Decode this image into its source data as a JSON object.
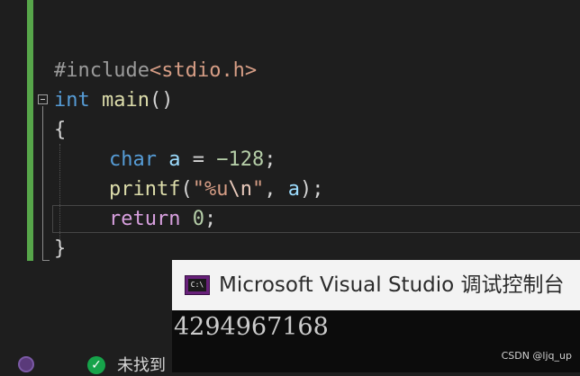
{
  "editor": {
    "lines": [
      {
        "tokens": [
          "#include",
          "<stdio.h>"
        ]
      },
      {
        "tokens": [
          "int",
          " ",
          "main",
          "()"
        ]
      },
      {
        "tokens": [
          "{"
        ]
      },
      {
        "tokens": [
          "char",
          " ",
          "a",
          " = ",
          "−128",
          ";"
        ]
      },
      {
        "tokens": [
          "printf",
          "(",
          "\"%u",
          "\\n",
          "\"",
          ", ",
          "a",
          ");"
        ]
      },
      {
        "tokens": [
          "return",
          " ",
          "0",
          ";"
        ]
      },
      {
        "tokens": [
          "}"
        ]
      }
    ]
  },
  "console": {
    "title": "Microsoft Visual Studio 调试控制台",
    "icon_label": "C:\\",
    "output": "4294967168"
  },
  "status": {
    "text": "未找到"
  },
  "watermark": "CSDN @ljq_up",
  "colors": {
    "keyword": "#569cd6",
    "function": "#dcdcaa",
    "variable": "#9cdcfe",
    "number": "#b5cea8",
    "string": "#d69d85",
    "control": "#d8a0df",
    "gutter_change": "#57a64a",
    "vs_purple": "#68217a"
  }
}
